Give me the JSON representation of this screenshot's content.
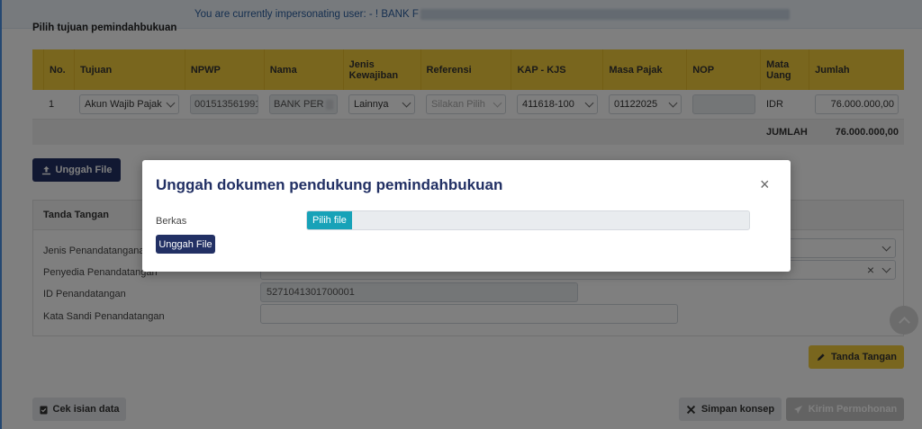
{
  "banner": {
    "text": "You are currently impersonating user: - ! BANK F"
  },
  "section": {
    "title": "Pilih tujuan pemindahbukuan"
  },
  "table": {
    "headers": [
      "No.",
      "Tujuan",
      "NPWP",
      "Nama",
      "Jenis Kewajiban",
      "Referensi",
      "KAP - KJS",
      "Masa Pajak",
      "NOP",
      "Mata Uang",
      "Jumlah"
    ],
    "row": {
      "no": "1",
      "tujuan": "Akun Wajib Pajak",
      "npwp": "001513561991",
      "nama": "BANK PER",
      "jenis": "Lainnya",
      "referensi_placeholder": "Silakan Pilih",
      "kap": "411618-100",
      "masa": "01122025",
      "nop": "",
      "mata_uang": "IDR",
      "jumlah": "76.000.000,00"
    },
    "total_label": "JUMLAH",
    "total_value": "76.000.000,00"
  },
  "upload_button": {
    "label": "Unggah File"
  },
  "signature": {
    "title": "Tanda Tangan",
    "jenis_label": "Jenis Penandatanganan*",
    "penyedia_label": "Penyedia Penandatangan",
    "id_label": "ID Penandatangan",
    "id_value": "5271041301700001",
    "sandi_label": "Kata Sandi Penandatangan",
    "sign_button": "Tanda Tangan"
  },
  "footer": {
    "check_button": "Cek isian data",
    "save_button": "Simpan konsep",
    "submit_button": "Kirim Permohonan"
  },
  "modal": {
    "title": "Unggah dokumen pendukung pemindahbukuan",
    "close": "×",
    "field_label": "Berkas",
    "file_button": "Pilih file",
    "upload_button": "Unggah File"
  },
  "colors": {
    "primary": "#223064",
    "accent": "#f3cc3c",
    "info": "#17a2b8"
  }
}
